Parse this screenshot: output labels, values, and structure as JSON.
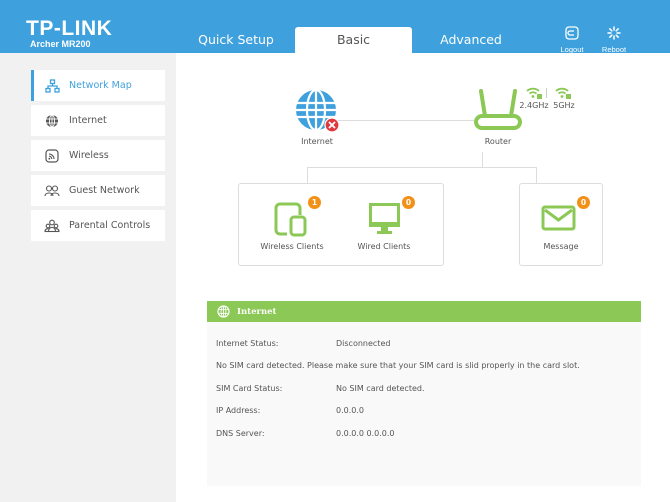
{
  "header": {
    "brand": "TP-LINK",
    "model": "Archer MR200",
    "tabs": [
      {
        "label": "Quick Setup",
        "active": false
      },
      {
        "label": "Basic",
        "active": true
      },
      {
        "label": "Advanced",
        "active": false
      }
    ],
    "actions": [
      {
        "label": "Logout",
        "icon": "logout-icon"
      },
      {
        "label": "Reboot",
        "icon": "reboot-icon"
      }
    ]
  },
  "sidebar": {
    "items": [
      {
        "label": "Network Map",
        "icon": "network-map-icon",
        "active": true
      },
      {
        "label": "Internet",
        "icon": "globe-icon",
        "active": false
      },
      {
        "label": "Wireless",
        "icon": "wireless-icon",
        "active": false
      },
      {
        "label": "Guest Network",
        "icon": "guest-network-icon",
        "active": false
      },
      {
        "label": "Parental Controls",
        "icon": "parental-controls-icon",
        "active": false
      }
    ]
  },
  "network_map": {
    "internet": {
      "label": "Internet",
      "status": "disconnected"
    },
    "router": {
      "label": "Router",
      "bands": [
        "2.4GHz",
        "5GHz"
      ]
    },
    "wireless_clients": {
      "label": "Wireless Clients",
      "count": "1"
    },
    "wired_clients": {
      "label": "Wired Clients",
      "count": "0"
    },
    "message": {
      "label": "Message",
      "count": "0"
    }
  },
  "internet_panel": {
    "title": "Internet",
    "rows": [
      {
        "label": "Internet Status:",
        "value": "Disconnected"
      },
      {
        "label": "No SIM card detected. Please make sure that your SIM card is slid properly in the card slot.",
        "value": ""
      },
      {
        "label": "SIM Card Status:",
        "value": "No SIM card detected."
      },
      {
        "label": "IP Address:",
        "value": "0.0.0.0"
      },
      {
        "label": "DNS Server:",
        "value": "0.0.0.0 0.0.0.0"
      }
    ]
  },
  "colors": {
    "brand_blue": "#3ea1dd",
    "accent_green": "#8bc855",
    "badge_orange": "#f39017",
    "error_red": "#e0383e"
  }
}
